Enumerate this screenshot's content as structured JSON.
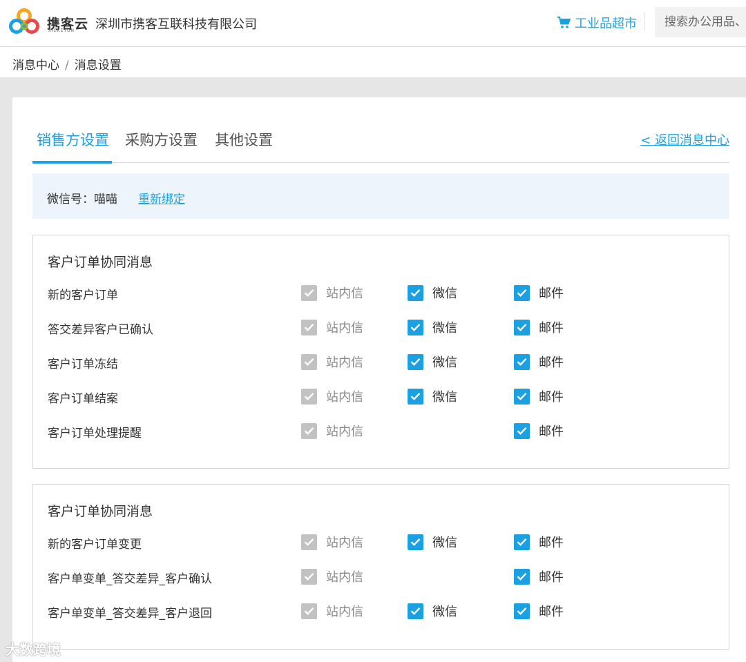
{
  "header": {
    "logo_text": "携客云",
    "logo_sub": "XIEKEYUN",
    "company": "深圳市携客互联科技有限公司",
    "mall_label": "工业品超市",
    "search_placeholder": "搜索办公用品、"
  },
  "breadcrumb": {
    "home": "消息中心",
    "separator": "/",
    "current": "消息设置"
  },
  "tabs": [
    {
      "label": "销售方设置",
      "active": true
    },
    {
      "label": "采购方设置",
      "active": false
    },
    {
      "label": "其他设置",
      "active": false
    }
  ],
  "back_link": "< 返回消息中心",
  "wechat": {
    "label": "微信号：喵喵",
    "rebind": "重新绑定"
  },
  "option_labels": {
    "site": "站内信",
    "wechat": "微信",
    "email": "邮件"
  },
  "sections": [
    {
      "title": "客户订单协同消息",
      "rows": [
        {
          "label": "新的客户订单",
          "site": true,
          "wechat": true,
          "email": true
        },
        {
          "label": "答交差异客户已确认",
          "site": true,
          "wechat": true,
          "email": true
        },
        {
          "label": "客户订单冻结",
          "site": true,
          "wechat": true,
          "email": true
        },
        {
          "label": "客户订单结案",
          "site": true,
          "wechat": true,
          "email": true
        },
        {
          "label": "客户订单处理提醒",
          "site": true,
          "wechat": false,
          "email": true
        }
      ]
    },
    {
      "title": "客户订单协同消息",
      "rows": [
        {
          "label": "新的客户订单变更",
          "site": true,
          "wechat": true,
          "email": true
        },
        {
          "label": "客户单变单_答交差异_客户确认",
          "site": true,
          "wechat": false,
          "email": true
        },
        {
          "label": "客户单变单_答交差异_客户退回",
          "site": true,
          "wechat": true,
          "email": true
        }
      ]
    }
  ],
  "watermark": "大数跨境",
  "colors": {
    "accent": "#1ba1e2",
    "disabled_checkbox": "#c2c2c2",
    "info_bg": "#eef4fb",
    "page_bg": "#e6e6e6"
  }
}
